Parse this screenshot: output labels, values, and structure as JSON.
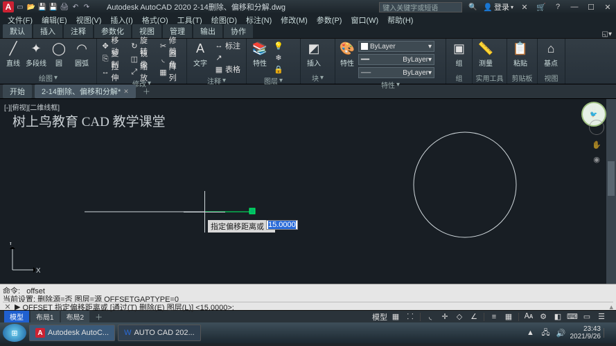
{
  "titlebar": {
    "title": "Autodesk AutoCAD 2020   2-14删除、偏移和分解.dwg",
    "search_placeholder": "键入关键字或短语",
    "login": "登录"
  },
  "menu": [
    "文件(F)",
    "编辑(E)",
    "视图(V)",
    "插入(I)",
    "格式(O)",
    "工具(T)",
    "绘图(D)",
    "标注(N)",
    "修改(M)",
    "参数(P)",
    "窗口(W)",
    "帮助(H)"
  ],
  "ribbon_tabs": [
    "默认",
    "插入",
    "注释",
    "参数化",
    "视图",
    "管理",
    "输出",
    "协作"
  ],
  "panels": {
    "draw": {
      "title": "绘图",
      "line": "直线",
      "polyline": "多段线",
      "circle": "圆",
      "arc": "圆弧"
    },
    "modify": {
      "title": "修改",
      "move": "移动",
      "copy": "复制",
      "stretch": "拉伸",
      "rotate": "旋转",
      "mirror": "镜像",
      "scale": "缩放",
      "trim": "修剪",
      "fillet": "圆角",
      "array": "阵列"
    },
    "annotate": {
      "title": "注释",
      "text": "文字",
      "dim": "标注",
      "table": "表格"
    },
    "layers": {
      "title": "图层",
      "props": "特性",
      "bylayer": "ByLayer"
    },
    "block": {
      "title": "块",
      "insert": "插入"
    },
    "props": {
      "title": "特性",
      "label": "特性"
    },
    "groups": {
      "title": "组",
      "label": "组"
    },
    "utils": {
      "title": "实用工具",
      "measure": "测量"
    },
    "clipboard": {
      "title": "剪贴板",
      "paste": "粘贴"
    },
    "view": {
      "title": "视图",
      "basepoint": "基点"
    }
  },
  "file_tabs": {
    "start": "开始",
    "doc": "2-14删除、偏移和分解*"
  },
  "viewport": {
    "label": "[-][俯视][二维线框]",
    "watermark": "树上鸟教育 CAD 教学课堂",
    "dyn_prompt": "指定偏移距离或",
    "dyn_value": "15.0000"
  },
  "cmd": {
    "line1": "命令: _offset",
    "line2": "当前设置: 删除源=否  图层=源  OFFSETGAPTYPE=0",
    "line3_a": "OFFSET 指定偏移距离或 [通过(T) 删除(E) 图层(L)] <15.0000>:"
  },
  "layout_tabs": [
    "模型",
    "布局1",
    "布局2"
  ],
  "status": {
    "mode": "模型"
  },
  "taskbar": {
    "app1": "Autodesk AutoC...",
    "app2": "AUTO  CAD 202...",
    "time": "23:43",
    "date": "2021/9/26"
  }
}
